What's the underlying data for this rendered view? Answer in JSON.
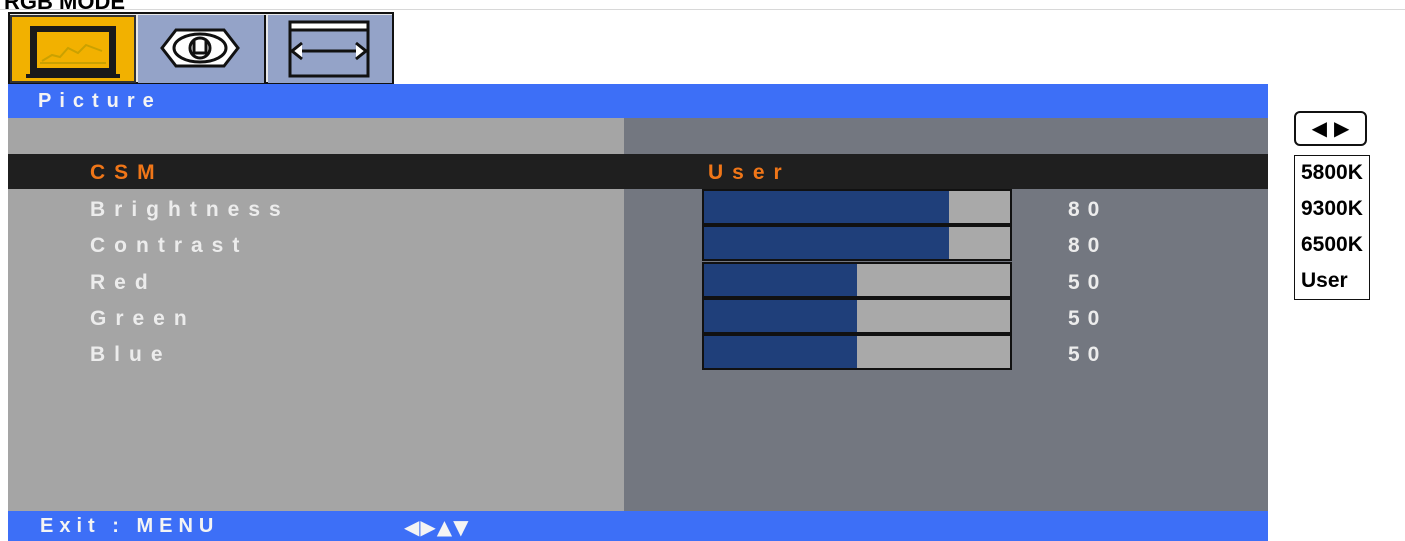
{
  "page": {
    "title": "RGB MODE"
  },
  "tabs": [
    {
      "name": "picture",
      "active": true
    },
    {
      "name": "osd",
      "active": false
    },
    {
      "name": "position",
      "active": false
    }
  ],
  "menu": {
    "title": "Picture",
    "rows": [
      {
        "label": "CSM",
        "value": "User",
        "selected": true
      },
      {
        "label": "Brightness",
        "value": "80",
        "level": 0.8
      },
      {
        "label": "Contrast",
        "value": "80",
        "level": 0.8
      },
      {
        "label": "Red",
        "value": "50",
        "level": 0.5
      },
      {
        "label": "Green",
        "value": "50",
        "level": 0.5
      },
      {
        "label": "Blue",
        "value": "50",
        "level": 0.5
      }
    ]
  },
  "footer": {
    "exit": "Exit : MENU",
    "arrows": "◀▶▲▼"
  },
  "side": {
    "arrow_key": "◀ ▶",
    "options": [
      "5800K",
      "9300K",
      "6500K",
      "User"
    ]
  },
  "colors": {
    "accent": "#3d6ff7",
    "selected_text": "#f07618",
    "bar_fill": "#1f3f7a",
    "tab_active": "#f2b100",
    "tab_inactive": "#94a3c8"
  },
  "icons": [
    "monitor-picture-icon",
    "osd-eye-icon",
    "position-window-icon"
  ]
}
